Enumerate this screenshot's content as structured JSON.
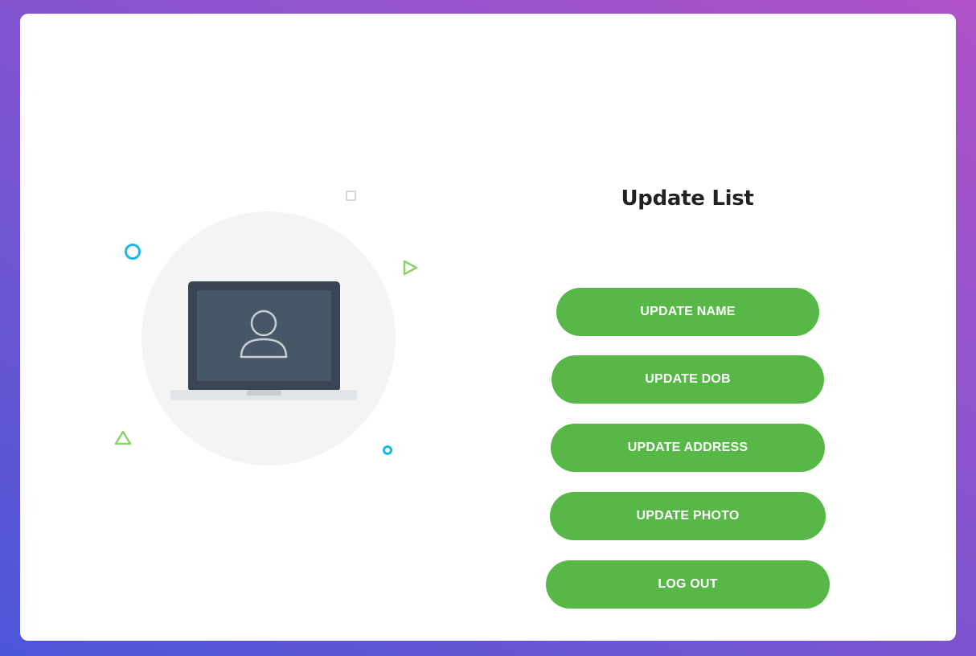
{
  "page": {
    "title": "Update List"
  },
  "buttons": {
    "update_name": "UPDATE NAME",
    "update_dob": "UPDATE DOB",
    "update_address": "UPDATE ADDRESS",
    "update_photo": "UPDATE PHOTO",
    "log_out": "LOG OUT"
  },
  "colors": {
    "button_green": "#57b848",
    "background_gradient_start": "#4a56d6",
    "background_gradient_end": "#b052c8",
    "accent_blue": "#1ab7ea",
    "accent_green": "#8cd26a"
  },
  "icons": {
    "illustration": "laptop-user-icon"
  }
}
